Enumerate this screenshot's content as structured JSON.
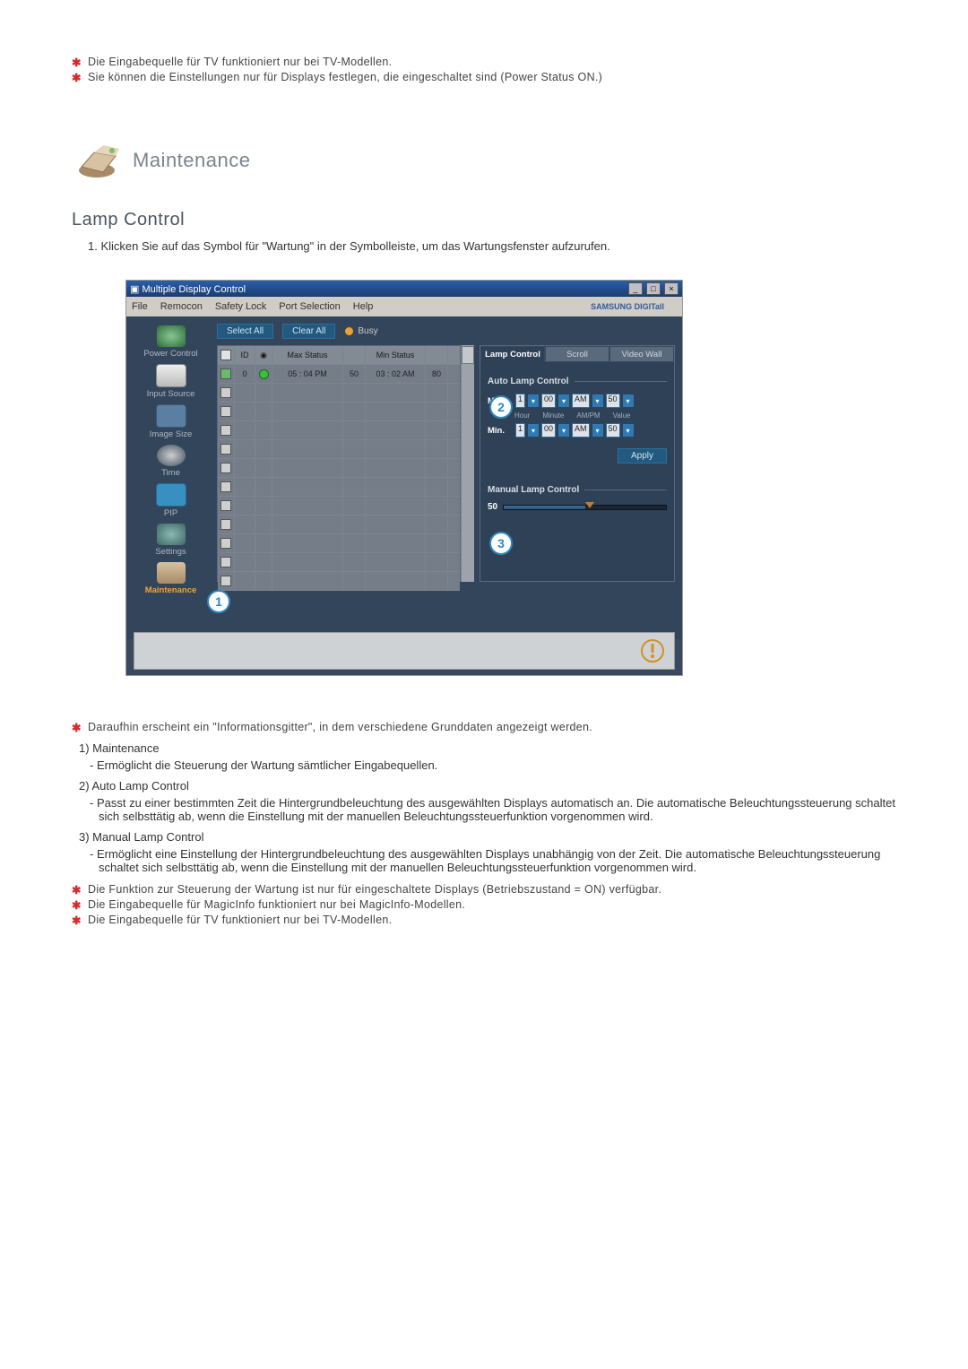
{
  "top_notes": [
    "Die Eingabequelle für TV funktioniert nur bei TV-Modellen.",
    "Sie können die Einstellungen nur für Displays festlegen, die eingeschaltet sind (Power Status ON.)"
  ],
  "section_title": "Maintenance",
  "sub_heading": "Lamp Control",
  "step1": "Klicken Sie auf das Symbol für \"Wartung\" in der Symbolleiste, um das Wartungsfenster aufzurufen.",
  "app": {
    "title": "Multiple Display Control",
    "menu": {
      "file": "File",
      "remocon": "Remocon",
      "safety": "Safety Lock",
      "port": "Port Selection",
      "help": "Help"
    },
    "brand": "SAMSUNG DIGITall",
    "sidebar": {
      "power": "Power Control",
      "input": "Input Source",
      "image": "Image Size",
      "time": "Time",
      "pip": "PIP",
      "settings": "Settings",
      "maintenance": "Maintenance"
    },
    "buttons": {
      "select_all": "Select All",
      "clear_all": "Clear All",
      "busy": "Busy",
      "apply": "Apply"
    },
    "grid": {
      "headers": {
        "id": "ID",
        "max_status": "Max Status",
        "min_status": "Min Status"
      },
      "row": {
        "id": "0",
        "max_time": "05 : 04 PM",
        "max_val": "50",
        "min_time": "03 : 02 AM",
        "min_val": "80"
      }
    },
    "tabs": {
      "lamp": "Lamp Control",
      "scroll": "Scroll",
      "video": "Video Wall"
    },
    "auto_lamp": {
      "title": "Auto Lamp Control",
      "max": "Max.",
      "min": "Min.",
      "hour_v": "1",
      "minute_v": "00",
      "ampm_v": "AM",
      "value_v": "50",
      "col": {
        "hour": "Hour",
        "minute": "Minute",
        "ampm": "AM/PM",
        "value": "Value"
      }
    },
    "manual_lamp": {
      "title": "Manual Lamp Control",
      "value": "50"
    },
    "callouts": {
      "c1": "1",
      "c2": "2",
      "c3": "3"
    }
  },
  "info_note": "Daraufhin erscheint ein \"Informationsgitter\", in dem verschiedene Grunddaten angezeigt werden.",
  "items": {
    "n1": "1)  Maintenance",
    "d1": "- Ermöglicht die Steuerung der Wartung sämtlicher Eingabequellen.",
    "n2": "2)  Auto Lamp Control",
    "d2": "- Passt zu einer bestimmten Zeit die Hintergrundbeleuchtung des ausgewählten Displays automatisch an. Die automatische Beleuchtungssteuerung schaltet sich selbsttätig ab, wenn die Einstellung mit der manuellen Beleuchtungssteuerfunktion vorgenommen wird.",
    "n3": "3)  Manual Lamp Control",
    "d3": "- Ermöglicht eine Einstellung der Hintergrundbeleuchtung des ausgewählten Displays unabhängig von der Zeit. Die automatische Beleuchtungssteuerung schaltet sich selbsttätig ab, wenn die Einstellung mit der manuellen Beleuchtungssteuerfunktion vorgenommen wird."
  },
  "bottom_notes": [
    "Die Funktion zur Steuerung der Wartung ist nur für eingeschaltete Displays (Betriebszustand = ON) verfügbar.",
    "Die Eingabequelle für MagicInfo funktioniert nur bei MagicInfo-Modellen.",
    "Die Eingabequelle für TV funktioniert nur bei TV-Modellen."
  ]
}
